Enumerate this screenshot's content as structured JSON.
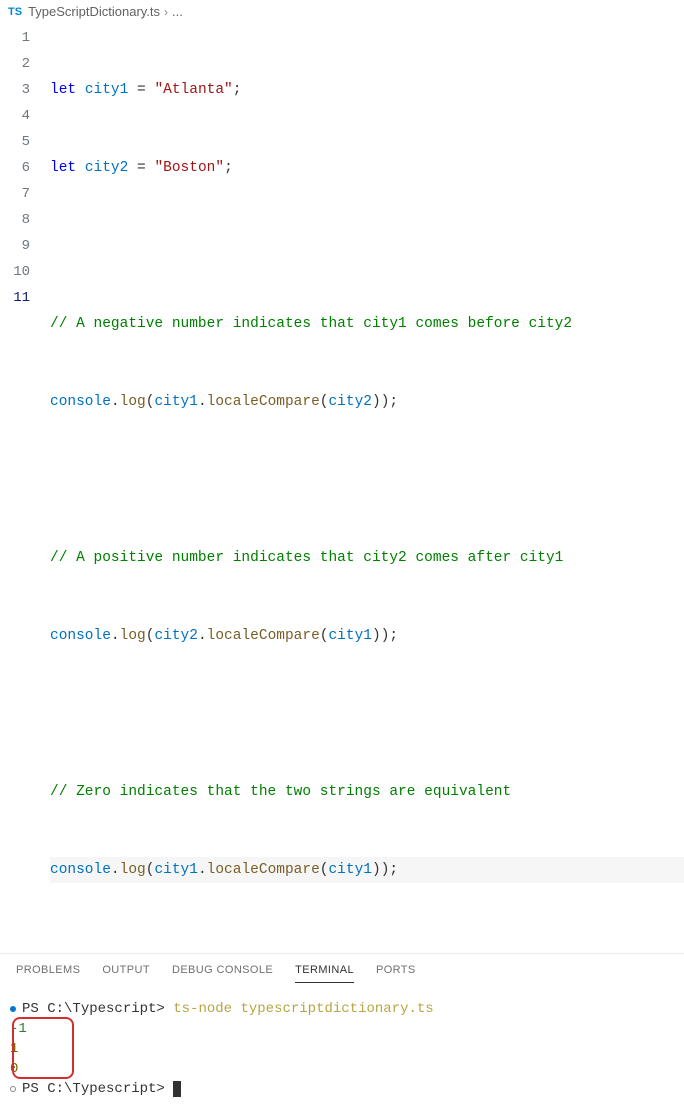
{
  "breadcrumb": {
    "icon_label": "TS",
    "filename": "TypeScriptDictionary.ts",
    "rest": "..."
  },
  "code": {
    "lines": [
      {
        "n": "1"
      },
      {
        "n": "2"
      },
      {
        "n": "3"
      },
      {
        "n": "4"
      },
      {
        "n": "5"
      },
      {
        "n": "6"
      },
      {
        "n": "7"
      },
      {
        "n": "8"
      },
      {
        "n": "9"
      },
      {
        "n": "10"
      },
      {
        "n": "11"
      }
    ],
    "l1": {
      "kw": "let",
      "var": "city1",
      "eq": " = ",
      "str": "\"Atlanta\"",
      "semi": ";"
    },
    "l2": {
      "kw": "let",
      "var": "city2",
      "eq": " = ",
      "str": "\"Boston\"",
      "semi": ";"
    },
    "l4": {
      "cm": "// A negative number indicates that city1 comes before city2"
    },
    "l5": {
      "obj": "console",
      "d1": ".",
      "fn1": "log",
      "p1": "(",
      "v1": "city1",
      "d2": ".",
      "fn2": "localeCompare",
      "p2": "(",
      "v2": "city2",
      "p3": "));"
    },
    "l7": {
      "cm": "// A positive number indicates that city2 comes after city1"
    },
    "l8": {
      "obj": "console",
      "d1": ".",
      "fn1": "log",
      "p1": "(",
      "v1": "city2",
      "d2": ".",
      "fn2": "localeCompare",
      "p2": "(",
      "v2": "city1",
      "p3": "));"
    },
    "l10": {
      "cm": "// Zero indicates that the two strings are equivalent"
    },
    "l11": {
      "obj": "console",
      "d1": ".",
      "fn1": "log",
      "p1": "(",
      "v1": "city1",
      "d2": ".",
      "fn2": "localeCompare",
      "p2": "(",
      "v2": "city1",
      "p3": "));"
    }
  },
  "panel": {
    "tabs": {
      "problems": "PROBLEMS",
      "output": "OUTPUT",
      "debug": "DEBUG CONSOLE",
      "terminal": "TERMINAL",
      "ports": "PORTS"
    }
  },
  "terminal": {
    "prompt1_ps": "PS ",
    "prompt1_path": "C:\\Typescript> ",
    "prompt1_cmd": "ts-node typescriptdictionary.ts",
    "out1": "-1",
    "out2": "1",
    "out3": "0",
    "prompt2_ps": "PS ",
    "prompt2_path": "C:\\Typescript> "
  }
}
